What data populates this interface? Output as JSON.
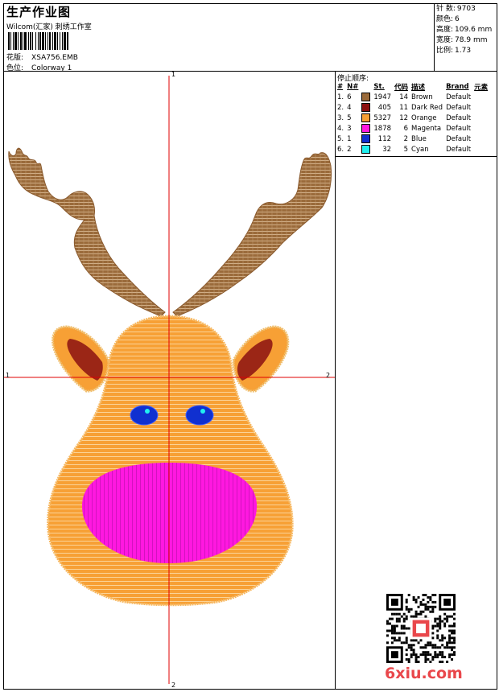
{
  "header": {
    "title": "生产作业图",
    "company": "Wilcom(汇家) 刺绣工作室",
    "design_label": "花版:",
    "design_value": "XSA756.EMB",
    "colorway_label": "色位:",
    "colorway_value": "Colorway 1"
  },
  "stats": [
    {
      "label": "针 数:",
      "value": "9703"
    },
    {
      "label": "颜色:",
      "value": "6"
    },
    {
      "label": "高度:",
      "value": "109.6 mm"
    },
    {
      "label": "宽度:",
      "value": "78.9 mm"
    },
    {
      "label": "比例:",
      "value": "1.73"
    }
  ],
  "threads": {
    "title": "停止顺序:",
    "headers": [
      "#",
      "N#",
      "St.",
      "代码",
      "描述",
      "Brand",
      "元素"
    ],
    "rows": [
      {
        "idx": "1.",
        "n": "6",
        "color": "#9a6a3a",
        "st": "1947",
        "code": "14",
        "desc": "Brown",
        "brand": "Default"
      },
      {
        "idx": "2.",
        "n": "4",
        "color": "#8b1010",
        "st": "405",
        "code": "11",
        "desc": "Dark Red",
        "brand": "Default"
      },
      {
        "idx": "3.",
        "n": "5",
        "color": "#f7a035",
        "st": "5327",
        "code": "12",
        "desc": "Orange",
        "brand": "Default"
      },
      {
        "idx": "4.",
        "n": "3",
        "color": "#ff18e0",
        "st": "1878",
        "code": "6",
        "desc": "Magenta",
        "brand": "Default"
      },
      {
        "idx": "5.",
        "n": "1",
        "color": "#1030d0",
        "st": "112",
        "code": "2",
        "desc": "Blue",
        "brand": "Default"
      },
      {
        "idx": "6.",
        "n": "2",
        "color": "#20f0f0",
        "st": "32",
        "code": "5",
        "desc": "Cyan",
        "brand": "Default"
      }
    ]
  },
  "axis": {
    "top": "1",
    "bottom": "2",
    "left": "1",
    "right": "2"
  },
  "watermark": "6xiu.com"
}
